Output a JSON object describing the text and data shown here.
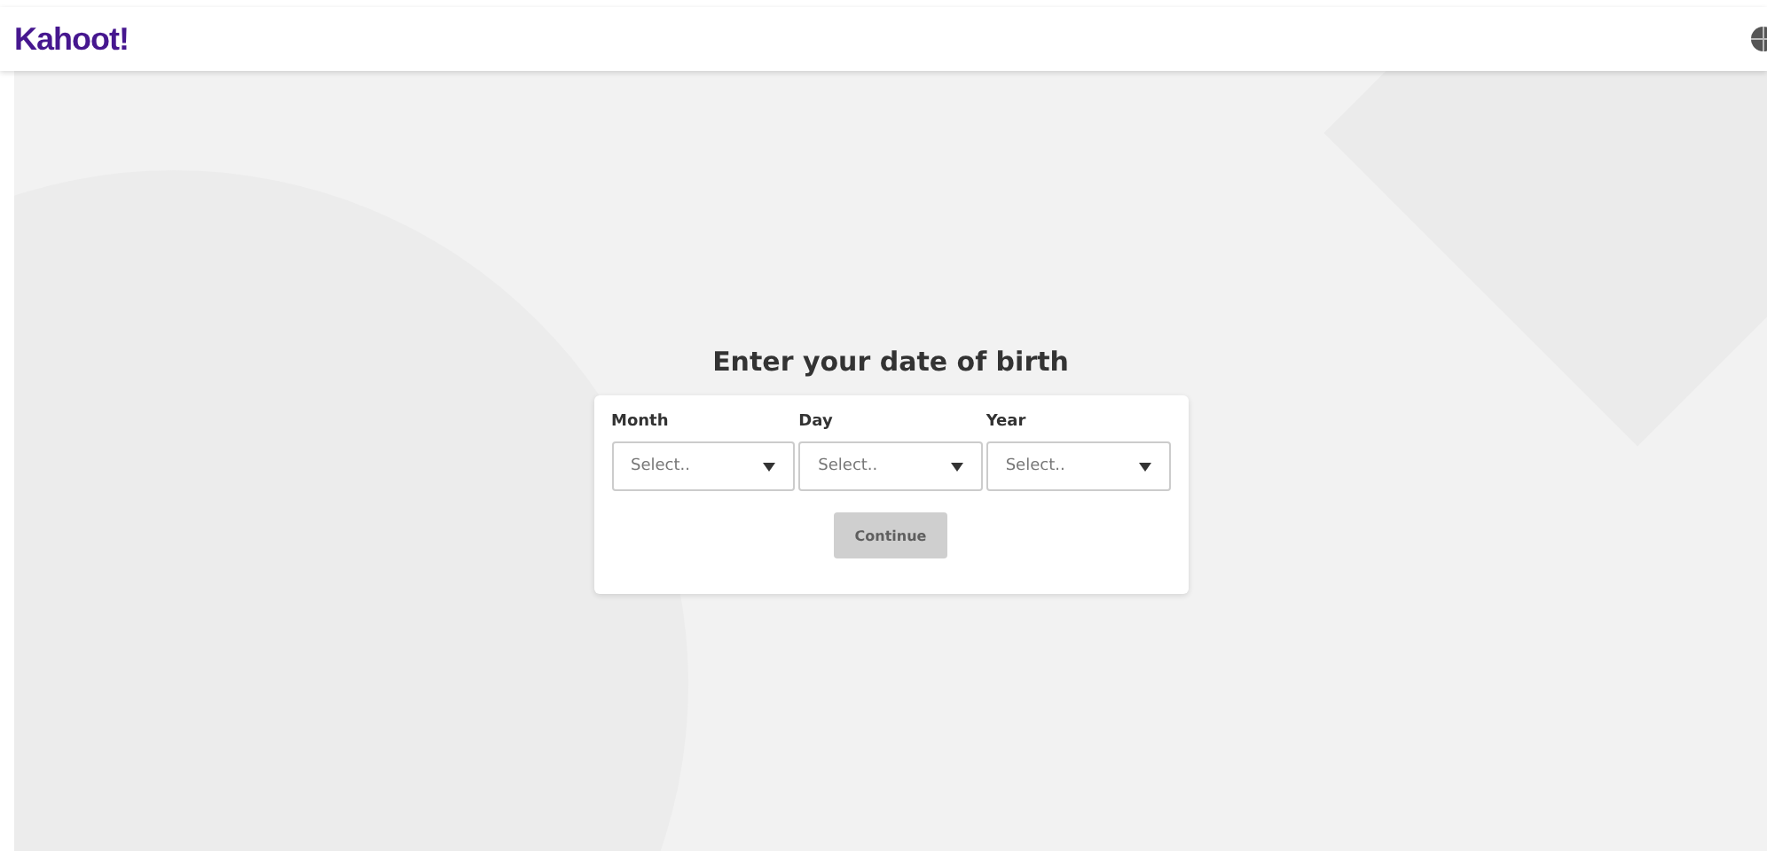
{
  "header": {
    "logo": "Kahoot!"
  },
  "form": {
    "title": "Enter your date of birth",
    "fields": [
      {
        "label": "Month",
        "placeholder": "Select.."
      },
      {
        "label": "Day",
        "placeholder": "Select.."
      },
      {
        "label": "Year",
        "placeholder": "Select.."
      }
    ],
    "button": {
      "label": "Continue",
      "disabled": true
    }
  }
}
